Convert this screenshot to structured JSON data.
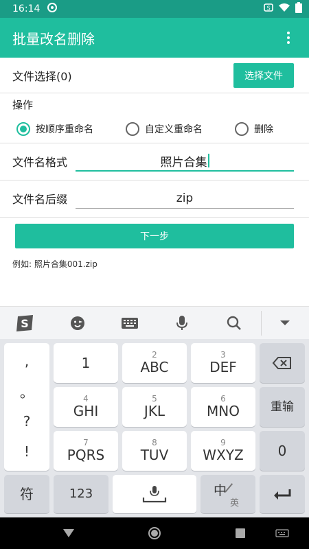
{
  "status": {
    "time": "16:14"
  },
  "appbar": {
    "title": "批量改名删除"
  },
  "file_select": {
    "label": "文件选择(0)",
    "button": "选择文件"
  },
  "operation": {
    "title": "操作",
    "options": [
      {
        "label": "按顺序重命名",
        "checked": true
      },
      {
        "label": "自定义重命名",
        "checked": false
      },
      {
        "label": "删除",
        "checked": false
      }
    ]
  },
  "fields": {
    "format_label": "文件名格式",
    "format_value": "照片合集",
    "suffix_label": "文件名后缀",
    "suffix_value": "zip"
  },
  "next_button": "下一步",
  "example": "例如: 照片合集001.zip",
  "keyboard": {
    "symbols": [
      ",",
      "。",
      "?",
      "!"
    ],
    "keys": [
      {
        "sub": "",
        "main": "1"
      },
      {
        "sub": "2",
        "main": "ABC"
      },
      {
        "sub": "3",
        "main": "DEF"
      },
      {
        "sub": "4",
        "main": "GHI"
      },
      {
        "sub": "5",
        "main": "JKL"
      },
      {
        "sub": "6",
        "main": "MNO"
      },
      {
        "sub": "7",
        "main": "PQRS"
      },
      {
        "sub": "8",
        "main": "TUV"
      },
      {
        "sub": "9",
        "main": "WXYZ"
      }
    ],
    "reenter": "重输",
    "zero": "0",
    "symbol_key": "符",
    "num_key": "123",
    "cn": "中",
    "en": "英"
  },
  "colors": {
    "accent": "#1fbe9e",
    "status_bar": "#1a9c86"
  }
}
